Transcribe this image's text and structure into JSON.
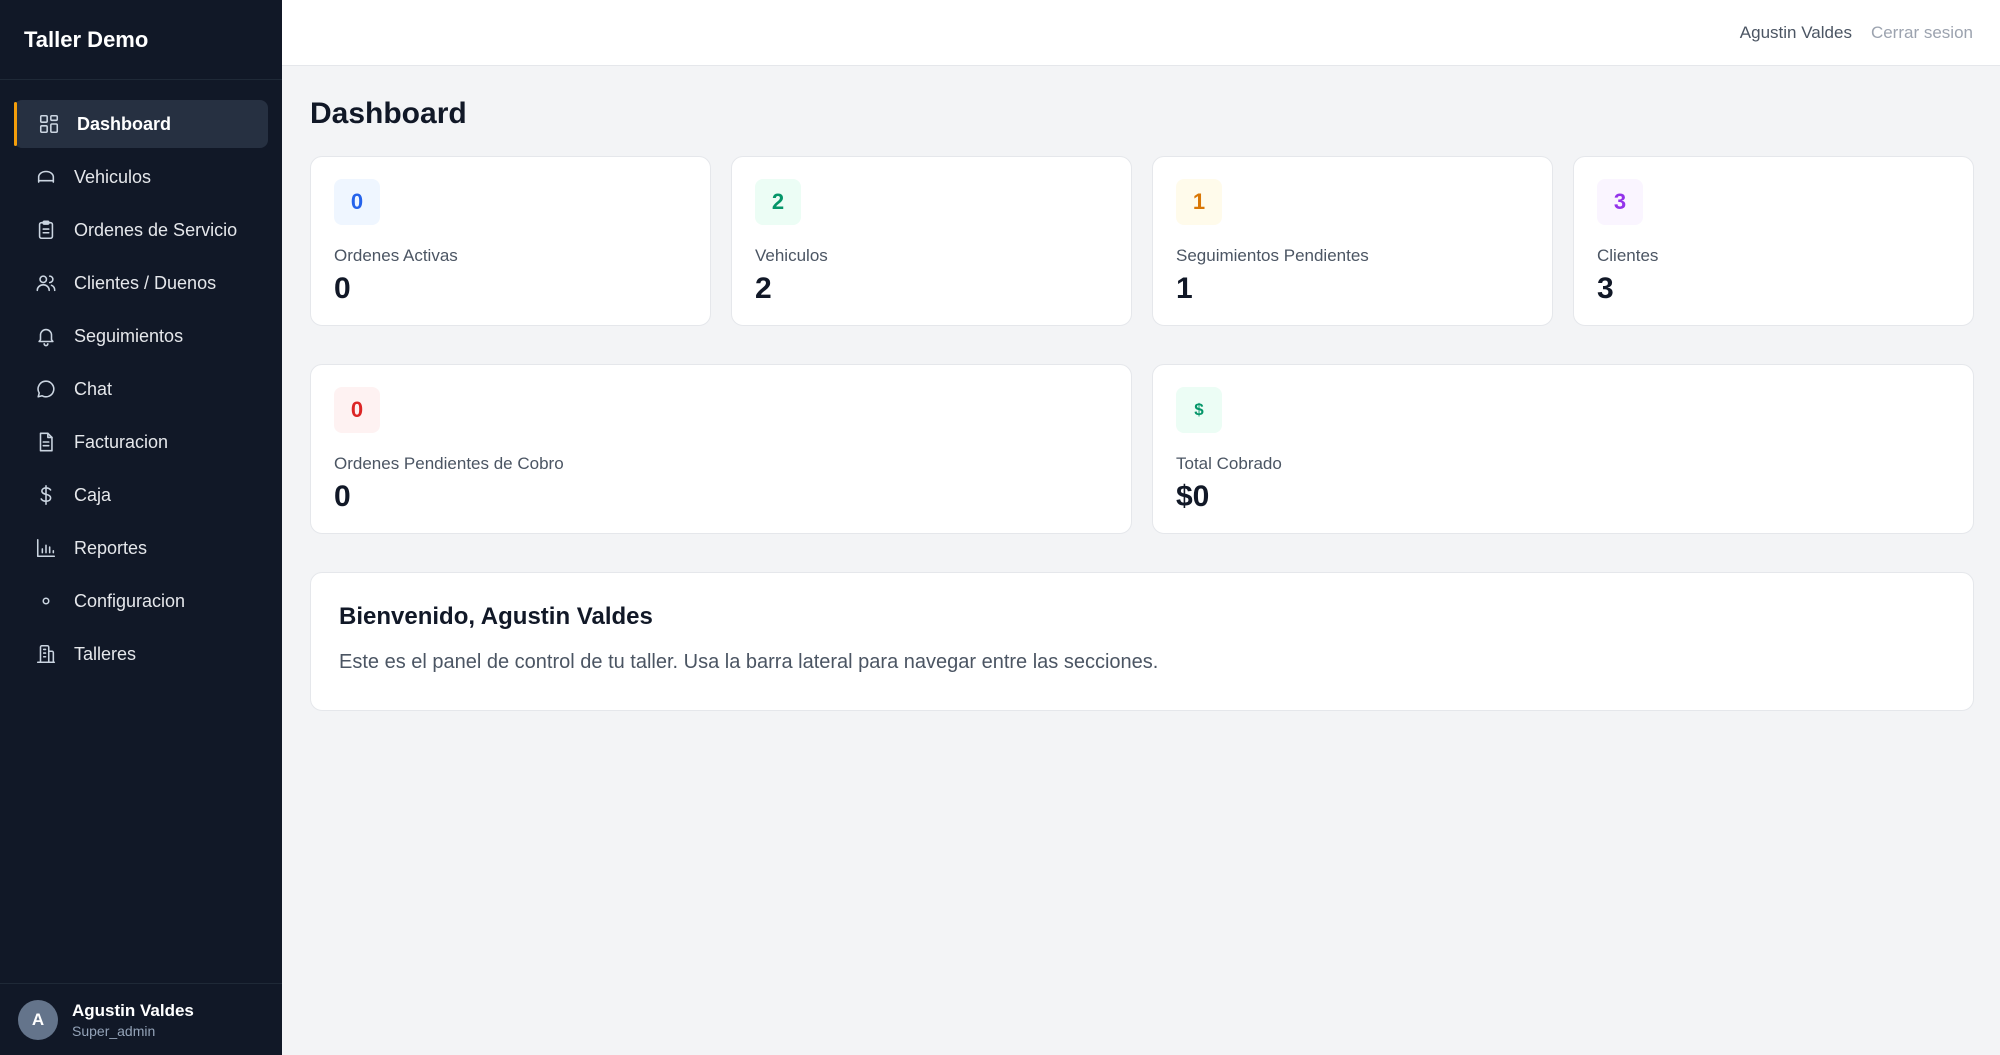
{
  "sidebar": {
    "brand": "Taller Demo",
    "items": [
      {
        "label": "Dashboard",
        "icon": "dashboard-icon",
        "active": true
      },
      {
        "label": "Vehiculos",
        "icon": "car-icon"
      },
      {
        "label": "Ordenes de Servicio",
        "icon": "clipboard-icon"
      },
      {
        "label": "Clientes / Duenos",
        "icon": "users-icon"
      },
      {
        "label": "Seguimientos",
        "icon": "bell-icon"
      },
      {
        "label": "Chat",
        "icon": "chat-icon"
      },
      {
        "label": "Facturacion",
        "icon": "invoice-icon"
      },
      {
        "label": "Caja",
        "icon": "dollar-icon"
      },
      {
        "label": "Reportes",
        "icon": "bar-chart-icon"
      },
      {
        "label": "Configuracion",
        "icon": "gear-icon"
      },
      {
        "label": "Talleres",
        "icon": "building-icon"
      }
    ],
    "user": {
      "initial": "A",
      "name": "Agustin Valdes",
      "role": "Super_admin"
    }
  },
  "topbar": {
    "user_name": "Agustin Valdes",
    "logout_label": "Cerrar sesion"
  },
  "main": {
    "title": "Dashboard",
    "stats": [
      {
        "badge": "0",
        "label": "Ordenes Activas",
        "value": "0",
        "color": "#2563eb"
      },
      {
        "badge": "2",
        "label": "Vehiculos",
        "value": "2",
        "color": "#059669"
      },
      {
        "badge": "1",
        "label": "Seguimientos Pendientes",
        "value": "1",
        "color": "#d97706"
      },
      {
        "badge": "3",
        "label": "Clientes",
        "value": "3",
        "color": "#9333ea"
      }
    ],
    "stats2": [
      {
        "badge": "0",
        "label": "Ordenes Pendientes de Cobro",
        "value": "0",
        "color": "#dc2626"
      },
      {
        "badge": "$",
        "label": "Total Cobrado",
        "value": "$0",
        "color": "#059669"
      }
    ],
    "welcome": {
      "title": "Bienvenido, Agustin Valdes",
      "text": "Este es el panel de control de tu taller. Usa la barra lateral para navegar entre las secciones."
    }
  },
  "colors": {
    "sidebar_bg": "#111827",
    "accent": "#f59e0b",
    "page_bg": "#f3f4f6"
  }
}
